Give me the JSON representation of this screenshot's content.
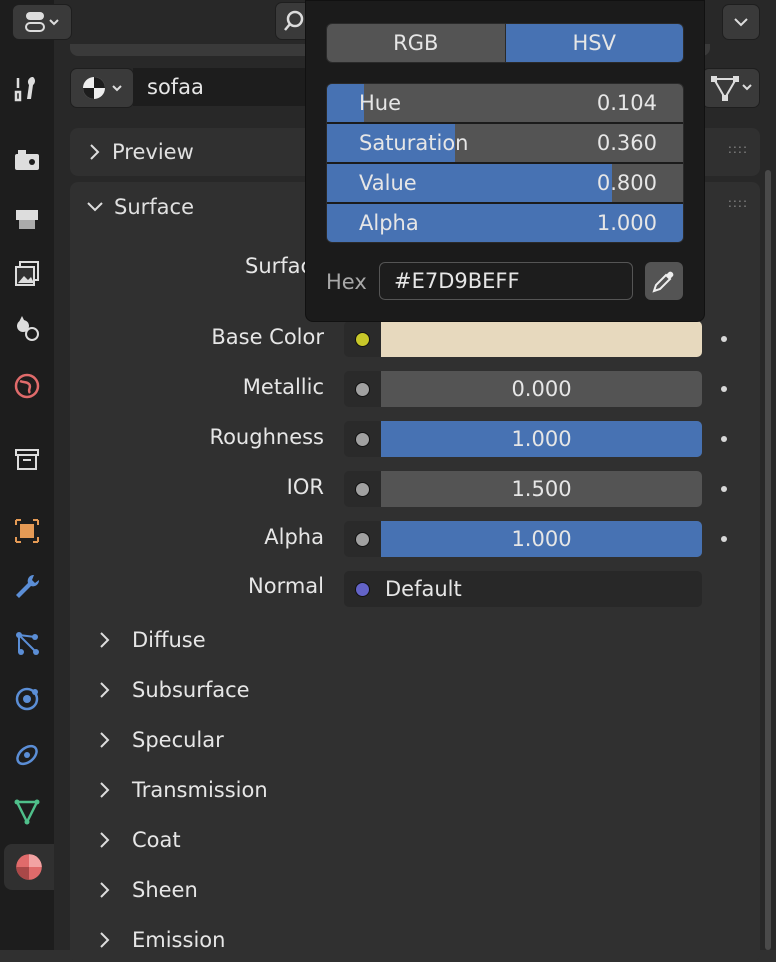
{
  "header": {
    "material_name": "sofaa"
  },
  "popup": {
    "modes": [
      "RGB",
      "HSV"
    ],
    "active_mode": "HSV",
    "sliders": [
      {
        "label": "Hue",
        "value": "0.104",
        "fraction": 0.104
      },
      {
        "label": "Saturation",
        "value": "0.360",
        "fraction": 0.36
      },
      {
        "label": "Value",
        "value": "0.800",
        "fraction": 0.8
      },
      {
        "label": "Alpha",
        "value": "1.000",
        "fraction": 1.0
      }
    ],
    "hex_label": "Hex",
    "hex_value": "#E7D9BEFF"
  },
  "panels": {
    "preview": "Preview",
    "surface": "Surface",
    "surface_row_label": "Surfac"
  },
  "properties": [
    {
      "label": "Base Color",
      "value": "",
      "socket_color": "#c7c729",
      "fill": 1.0,
      "field_color": "#e7d9be"
    },
    {
      "label": "Metallic",
      "value": "0.000",
      "socket_color": "#a1a1a1",
      "fill": 0.0
    },
    {
      "label": "Roughness",
      "value": "1.000",
      "socket_color": "#a1a1a1",
      "fill": 1.0
    },
    {
      "label": "IOR",
      "value": "1.500",
      "socket_color": "#a1a1a1",
      "fill": 0.0
    },
    {
      "label": "Alpha",
      "value": "1.000",
      "socket_color": "#a1a1a1",
      "fill": 1.0
    }
  ],
  "normal": {
    "label": "Normal",
    "value": "Default",
    "socket_color": "#6363c7"
  },
  "subsections": [
    "Diffuse",
    "Subsurface",
    "Specular",
    "Transmission",
    "Coat",
    "Sheen",
    "Emission"
  ],
  "colors": {
    "accent": "#4772b3",
    "base_color": "#e7d9be",
    "material_tab": "#e06b6b"
  },
  "sidebar_icons": [
    "tool-icon",
    "render-icon",
    "output-icon",
    "view-layer-icon",
    "scene-icon",
    "world-icon",
    "collection-icon",
    "object-icon",
    "modifier-icon",
    "particles-icon",
    "physics-icon",
    "constraints-icon",
    "data-icon",
    "material-icon"
  ]
}
